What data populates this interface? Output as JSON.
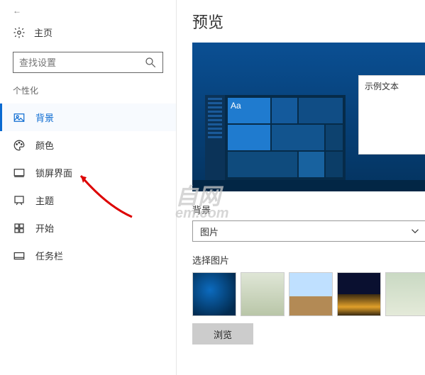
{
  "header": {
    "home": "主页"
  },
  "search": {
    "placeholder": "查找设置"
  },
  "category": "个性化",
  "nav": {
    "background": "背景",
    "colors": "颜色",
    "lockscreen": "锁屏界面",
    "themes": "主题",
    "start": "开始",
    "taskbar": "任务栏"
  },
  "main": {
    "preview_title": "预览",
    "sample_text": "示例文本",
    "bg_label": "背景",
    "bg_selected": "图片",
    "choose_label": "选择图片",
    "browse": "浏览"
  },
  "watermark": {
    "line1": "自网",
    "line2": "em.com"
  }
}
